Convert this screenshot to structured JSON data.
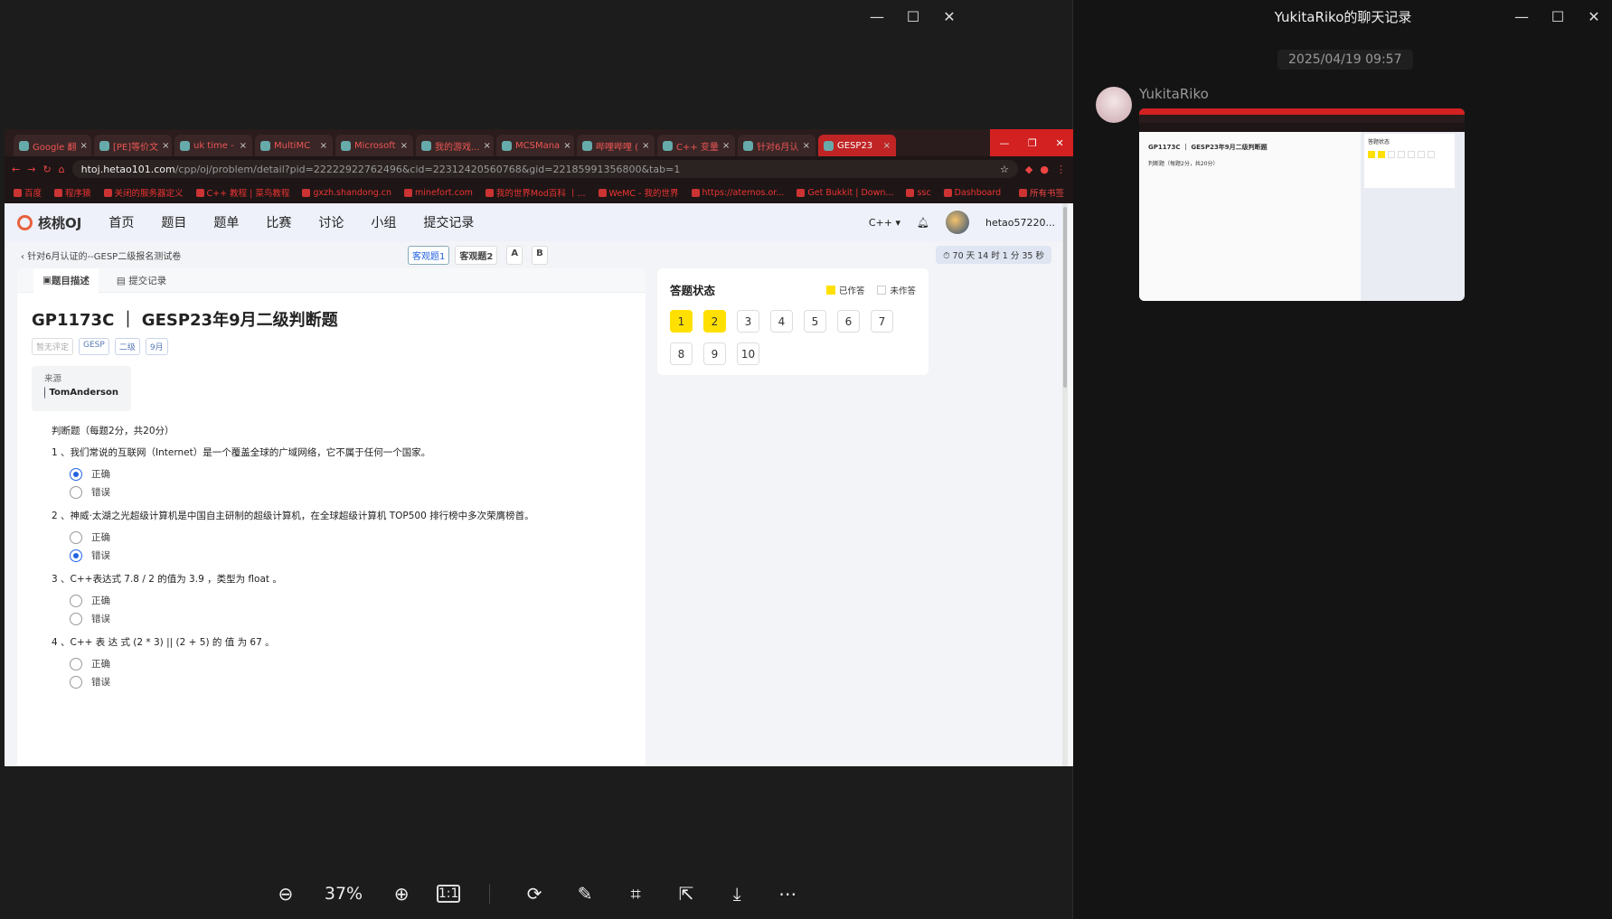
{
  "viewer": {
    "window_controls": [
      "—",
      "☐",
      "✕"
    ],
    "zoom": "37%",
    "tools": [
      "zoom-out-icon",
      "zoom-in-icon",
      "actual-size-icon",
      "rotate-icon",
      "edit-icon",
      "ocr-icon",
      "share-icon",
      "download-icon",
      "more-icon"
    ]
  },
  "browser": {
    "tabs": [
      {
        "label": "Google 翻",
        "active": false
      },
      {
        "label": "[PE]等价文",
        "active": false
      },
      {
        "label": "uk time -",
        "active": false
      },
      {
        "label": "MultiMC",
        "active": false
      },
      {
        "label": "Microsoft",
        "active": false
      },
      {
        "label": "我的游戏...",
        "active": false
      },
      {
        "label": "MCSMana",
        "active": false
      },
      {
        "label": "哔哩哔哩 (",
        "active": false
      },
      {
        "label": "C++ 变量",
        "active": false
      },
      {
        "label": "针对6月认",
        "active": false
      },
      {
        "label": "GESP23",
        "active": true
      }
    ],
    "url_host": "htoj.hetao101.com",
    "url_path": "/cpp/oj/problem/detail?pid=2222292276249​6&cid=22312420560768&gid=22185991356800&tab=1",
    "bookmarks": [
      "百度",
      "程序猿",
      "关闭的服务器定义",
      "C++ 教程 | 菜鸟教程",
      "gxzh.shandong.cn",
      "minefort.com",
      "我的世界Mod百科 丨...",
      "WeMC - 我的世界",
      "https://aternos.or...",
      "Get Bukkit | Down...",
      "ssc",
      "Dashboard"
    ],
    "bookmarks_folder": "所有书签"
  },
  "site": {
    "logo": "核桃OJ",
    "nav": [
      "首页",
      "题目",
      "题单",
      "比赛",
      "讨论",
      "小组",
      "提交记录"
    ],
    "lang": "C++",
    "username": "hetao57220...",
    "breadcrumb": "针对6月认证的--GESP二级报名测试卷",
    "section_pills": [
      "客观题1",
      "客观题2",
      "A",
      "B"
    ],
    "timer": "70 天 14 时 1 分 35 秒",
    "tab_desc": "题目描述",
    "tab_submit": "提交记录",
    "problem_title": "GP1173C ｜ GESP23年9月二级判断题",
    "tags": [
      "暂无评定",
      "GESP",
      "二级",
      "9月"
    ],
    "source_label": "来源",
    "source_user": "TomAnderson",
    "intro": "判断题（每题2分，共20分）",
    "questions": [
      {
        "text": "1 、我们常说的互联网（Internet）是一个覆盖全球的广域网络，它不属于任何一个国家。",
        "choice": 0
      },
      {
        "text": "2 、神威·太湖之光超级计算机是中国自主研制的超级计算机，在全球超级计算机 TOP500 排行榜中多次荣膺榜首。",
        "choice": 1
      },
      {
        "text": "3 、C++表达式 7.8 / 2 的值为 3.9 ，类型为 float 。",
        "choice": -1
      },
      {
        "text": "4 、C++ 表 达 式 (2 * 3) || (2 + 5) 的 值 为 67 。",
        "choice": -1
      }
    ],
    "option_true": "正确",
    "option_false": "错误",
    "status_title": "答题状态",
    "legend_done": "已作答",
    "legend_todo": "未作答",
    "answers": [
      {
        "n": "1",
        "done": true
      },
      {
        "n": "2",
        "done": true
      },
      {
        "n": "3",
        "done": false
      },
      {
        "n": "4",
        "done": false
      },
      {
        "n": "5",
        "done": false
      },
      {
        "n": "6",
        "done": false
      },
      {
        "n": "7",
        "done": false
      },
      {
        "n": "8",
        "done": false
      },
      {
        "n": "9",
        "done": false
      },
      {
        "n": "10",
        "done": false
      }
    ]
  },
  "chat": {
    "title": "YukitaRiko的聊天记录",
    "date": "2025/04/19 09:57",
    "sender": "YukitaRiko"
  }
}
